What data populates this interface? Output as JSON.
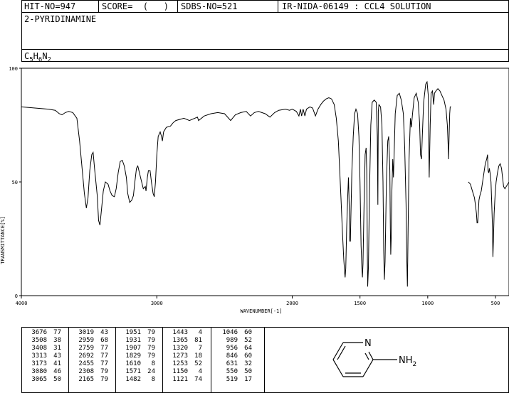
{
  "header": {
    "hit_no": "HIT-NO=947",
    "score": "SCORE=  (   )",
    "sdbs_no": "SDBS-NO=521",
    "ir_info": "IR-NIDA-06149 : CCL4 SOLUTION",
    "compound_name": "2-PYRIDINAMINE",
    "formula_parts": [
      "C",
      "5",
      "H",
      "6",
      "N",
      "2"
    ]
  },
  "chart_data": {
    "type": "line",
    "title": "",
    "xlabel": "WAVENUMBER[-1]",
    "ylabel": "TRANSMITTANCE[%]",
    "xlim": [
      4000,
      400
    ],
    "ylim": [
      0,
      100
    ],
    "x_ticks": [
      4000,
      3000,
      2000,
      1500,
      1000,
      500
    ],
    "y_ticks": [
      0,
      50,
      100
    ],
    "grid": false,
    "series": [
      {
        "points": [
          [
            4000,
            83
          ],
          [
            3900,
            82.5
          ],
          [
            3800,
            82
          ],
          [
            3750,
            81.5
          ],
          [
            3720,
            80
          ],
          [
            3700,
            79.5
          ],
          [
            3676,
            80.5
          ],
          [
            3650,
            81
          ],
          [
            3620,
            80.5
          ],
          [
            3590,
            78
          ],
          [
            3570,
            68
          ],
          [
            3550,
            55
          ],
          [
            3535,
            45
          ],
          [
            3520,
            38.5
          ],
          [
            3508,
            43
          ],
          [
            3495,
            55
          ],
          [
            3480,
            62
          ],
          [
            3470,
            63
          ],
          [
            3460,
            56
          ],
          [
            3440,
            44
          ],
          [
            3430,
            33
          ],
          [
            3420,
            31
          ],
          [
            3408,
            38
          ],
          [
            3395,
            46
          ],
          [
            3380,
            50
          ],
          [
            3360,
            49
          ],
          [
            3345,
            46
          ],
          [
            3330,
            44
          ],
          [
            3313,
            43.5
          ],
          [
            3300,
            47
          ],
          [
            3285,
            54
          ],
          [
            3270,
            59
          ],
          [
            3255,
            59.5
          ],
          [
            3240,
            57
          ],
          [
            3225,
            52
          ],
          [
            3215,
            45
          ],
          [
            3200,
            41
          ],
          [
            3185,
            42
          ],
          [
            3173,
            44
          ],
          [
            3160,
            51
          ],
          [
            3150,
            56
          ],
          [
            3140,
            57
          ],
          [
            3120,
            52
          ],
          [
            3100,
            47
          ],
          [
            3085,
            48
          ],
          [
            3080,
            46
          ],
          [
            3070,
            52
          ],
          [
            3062,
            55
          ],
          [
            3050,
            55
          ],
          [
            3040,
            50
          ],
          [
            3028,
            45
          ],
          [
            3019,
            43.5
          ],
          [
            3010,
            50
          ],
          [
            3000,
            62
          ],
          [
            2990,
            70
          ],
          [
            2975,
            72
          ],
          [
            2965,
            70
          ],
          [
            2959,
            68
          ],
          [
            2950,
            72
          ],
          [
            2930,
            74
          ],
          [
            2900,
            74.5
          ],
          [
            2880,
            76
          ],
          [
            2860,
            77
          ],
          [
            2800,
            78
          ],
          [
            2759,
            77
          ],
          [
            2700,
            78.5
          ],
          [
            2692,
            77
          ],
          [
            2650,
            79
          ],
          [
            2600,
            80
          ],
          [
            2550,
            80.5
          ],
          [
            2500,
            80
          ],
          [
            2455,
            77
          ],
          [
            2420,
            79.5
          ],
          [
            2380,
            80.5
          ],
          [
            2340,
            81
          ],
          [
            2308,
            79
          ],
          [
            2280,
            80.5
          ],
          [
            2250,
            81
          ],
          [
            2200,
            80
          ],
          [
            2165,
            78.5
          ],
          [
            2130,
            80.5
          ],
          [
            2100,
            81.5
          ],
          [
            2050,
            82
          ],
          [
            2020,
            81.5
          ],
          [
            2000,
            82
          ],
          [
            1970,
            81
          ],
          [
            1951,
            79
          ],
          [
            1940,
            82
          ],
          [
            1931,
            79
          ],
          [
            1920,
            82
          ],
          [
            1907,
            79
          ],
          [
            1895,
            82
          ],
          [
            1870,
            83
          ],
          [
            1850,
            82.5
          ],
          [
            1829,
            79
          ],
          [
            1810,
            82
          ],
          [
            1790,
            84
          ],
          [
            1770,
            85.5
          ],
          [
            1750,
            86.5
          ],
          [
            1730,
            87
          ],
          [
            1710,
            86.5
          ],
          [
            1690,
            84
          ],
          [
            1675,
            78
          ],
          [
            1660,
            68
          ],
          [
            1650,
            55
          ],
          [
            1640,
            42
          ],
          [
            1630,
            28
          ],
          [
            1620,
            16
          ],
          [
            1613,
            10
          ],
          [
            1610,
            8
          ],
          [
            1605,
            12
          ],
          [
            1598,
            30
          ],
          [
            1590,
            45
          ],
          [
            1585,
            52
          ],
          [
            1580,
            40
          ],
          [
            1575,
            24
          ],
          [
            1571,
            24
          ],
          [
            1567,
            35
          ],
          [
            1560,
            55
          ],
          [
            1550,
            70
          ],
          [
            1540,
            80
          ],
          [
            1530,
            82
          ],
          [
            1518,
            80
          ],
          [
            1508,
            70
          ],
          [
            1500,
            50
          ],
          [
            1492,
            22
          ],
          [
            1486,
            12
          ],
          [
            1482,
            8
          ],
          [
            1478,
            14
          ],
          [
            1470,
            40
          ],
          [
            1462,
            62
          ],
          [
            1455,
            65
          ],
          [
            1450,
            55
          ],
          [
            1446,
            20
          ],
          [
            1443,
            4
          ],
          [
            1438,
            12
          ],
          [
            1430,
            45
          ],
          [
            1420,
            75
          ],
          [
            1410,
            85
          ],
          [
            1395,
            86
          ],
          [
            1380,
            85
          ],
          [
            1372,
            70
          ],
          [
            1368,
            40
          ],
          [
            1365,
            81
          ],
          [
            1360,
            84
          ],
          [
            1348,
            83
          ],
          [
            1338,
            75
          ],
          [
            1330,
            50
          ],
          [
            1325,
            20
          ],
          [
            1320,
            7
          ],
          [
            1315,
            15
          ],
          [
            1305,
            50
          ],
          [
            1295,
            68
          ],
          [
            1288,
            70
          ],
          [
            1280,
            55
          ],
          [
            1276,
            30
          ],
          [
            1273,
            18
          ],
          [
            1270,
            25
          ],
          [
            1265,
            45
          ],
          [
            1258,
            60
          ],
          [
            1253,
            52
          ],
          [
            1248,
            62
          ],
          [
            1240,
            80
          ],
          [
            1225,
            88
          ],
          [
            1210,
            89
          ],
          [
            1195,
            86
          ],
          [
            1180,
            80
          ],
          [
            1170,
            65
          ],
          [
            1160,
            40
          ],
          [
            1154,
            15
          ],
          [
            1150,
            4
          ],
          [
            1146,
            25
          ],
          [
            1138,
            60
          ],
          [
            1128,
            78
          ],
          [
            1121,
            74
          ],
          [
            1112,
            80
          ],
          [
            1100,
            87
          ],
          [
            1085,
            89
          ],
          [
            1070,
            85
          ],
          [
            1060,
            76
          ],
          [
            1053,
            62
          ],
          [
            1046,
            60
          ],
          [
            1040,
            70
          ],
          [
            1030,
            85
          ],
          [
            1015,
            93
          ],
          [
            1005,
            94
          ],
          [
            996,
            88
          ],
          [
            989,
            52
          ],
          [
            982,
            75
          ],
          [
            975,
            89
          ],
          [
            965,
            90
          ],
          [
            956,
            84
          ],
          [
            950,
            89
          ],
          [
            940,
            90
          ],
          [
            925,
            91
          ],
          [
            910,
            90
          ],
          [
            895,
            88
          ],
          [
            880,
            86
          ],
          [
            865,
            82
          ],
          [
            855,
            75
          ],
          [
            848,
            64
          ],
          [
            846,
            60
          ],
          [
            843,
            68
          ],
          [
            838,
            80
          ],
          [
            834,
            83
          ],
          [
            828,
            83
          ]
        ]
      },
      {
        "points": [
          [
            700,
            50
          ],
          [
            685,
            49
          ],
          [
            670,
            46
          ],
          [
            655,
            43
          ],
          [
            648,
            40
          ],
          [
            640,
            36
          ],
          [
            636,
            32
          ],
          [
            631,
            32
          ],
          [
            627,
            36
          ],
          [
            622,
            42
          ],
          [
            615,
            44
          ],
          [
            605,
            46
          ],
          [
            595,
            50
          ],
          [
            585,
            54
          ],
          [
            575,
            58
          ],
          [
            565,
            60
          ],
          [
            558,
            62
          ],
          [
            555,
            55
          ],
          [
            550,
            54
          ],
          [
            545,
            56
          ],
          [
            540,
            54
          ],
          [
            533,
            50
          ],
          [
            527,
            40
          ],
          [
            522,
            30
          ],
          [
            519,
            17
          ],
          [
            515,
            24
          ],
          [
            510,
            36
          ],
          [
            502,
            45
          ],
          [
            495,
            50
          ],
          [
            485,
            54
          ],
          [
            475,
            57
          ],
          [
            465,
            58
          ],
          [
            455,
            56
          ],
          [
            448,
            52
          ],
          [
            440,
            48
          ],
          [
            430,
            47
          ],
          [
            420,
            48
          ],
          [
            410,
            49
          ],
          [
            400,
            50
          ]
        ]
      }
    ]
  },
  "peak_table": [
    [
      [
        "3676",
        "77"
      ],
      [
        "3508",
        "38"
      ],
      [
        "3408",
        "31"
      ],
      [
        "3313",
        "43"
      ],
      [
        "3173",
        "41"
      ],
      [
        "3080",
        "46"
      ],
      [
        "3065",
        "50"
      ]
    ],
    [
      [
        "3019",
        "43"
      ],
      [
        "2959",
        "68"
      ],
      [
        "2759",
        "77"
      ],
      [
        "2692",
        "77"
      ],
      [
        "2455",
        "77"
      ],
      [
        "2308",
        "79"
      ],
      [
        "2165",
        "79"
      ]
    ],
    [
      [
        "1951",
        "79"
      ],
      [
        "1931",
        "79"
      ],
      [
        "1907",
        "79"
      ],
      [
        "1829",
        "79"
      ],
      [
        "1610",
        "8"
      ],
      [
        "1571",
        "24"
      ],
      [
        "1482",
        "8"
      ]
    ],
    [
      [
        "1443",
        "4"
      ],
      [
        "1365",
        "81"
      ],
      [
        "1320",
        "7"
      ],
      [
        "1273",
        "18"
      ],
      [
        "1253",
        "52"
      ],
      [
        "1150",
        "4"
      ],
      [
        "1121",
        "74"
      ]
    ],
    [
      [
        "1046",
        "60"
      ],
      [
        "989",
        "52"
      ],
      [
        "956",
        "64"
      ],
      [
        "846",
        "60"
      ],
      [
        "631",
        "32"
      ],
      [
        "550",
        "50"
      ],
      [
        "519",
        "17"
      ]
    ]
  ],
  "structure": {
    "n_label": "N",
    "nh2_label": "NH",
    "nh2_sub": "2"
  }
}
